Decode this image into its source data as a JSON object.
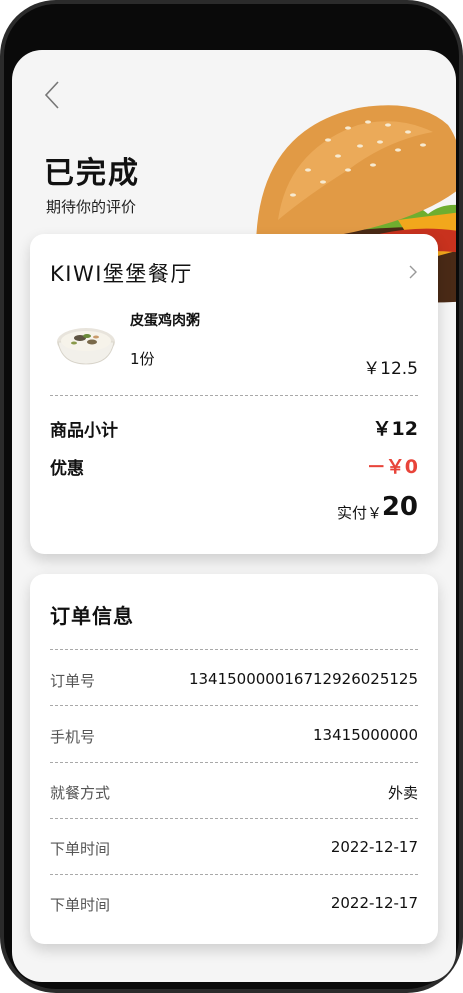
{
  "header": {
    "status_title": "已完成",
    "status_subtitle": "期待你的评价"
  },
  "store": {
    "name": "KIWI堡堡餐厅"
  },
  "items": [
    {
      "name": "皮蛋鸡肉粥",
      "quantity": "1份",
      "price": "￥12.5"
    }
  ],
  "summary": {
    "subtotal_label": "商品小计",
    "subtotal_value": "￥12",
    "discount_label": "优惠",
    "discount_value": "－￥0",
    "paid_label": "实付￥",
    "paid_value": "20"
  },
  "order_info": {
    "title": "订单信息",
    "rows": [
      {
        "label": "订单号",
        "value": "134150000016712926025125"
      },
      {
        "label": "手机号",
        "value": "13415000000"
      },
      {
        "label": "就餐方式",
        "value": "外卖"
      },
      {
        "label": "下单时间",
        "value": "2022-12-17"
      },
      {
        "label": "下单时间",
        "value": "2022-12-17"
      }
    ]
  },
  "colors": {
    "discount": "#e8443a",
    "background": "#f5f5f5",
    "card": "#ffffff"
  }
}
